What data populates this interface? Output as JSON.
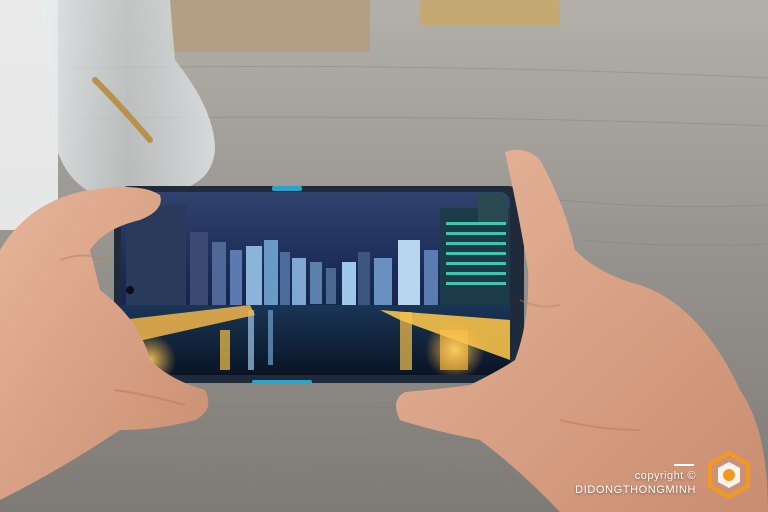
{
  "watermark": {
    "copyright": "copyright ©",
    "brand": "DIDONGTHONGMINH"
  },
  "icons": [
    "camera-shutter-logo-icon"
  ],
  "colors": {
    "table_wood": "#8c8a86",
    "phone_frame": "#1f2a3a",
    "accent_logo": "#f39a1e",
    "city_night_sky": "#1b2a55",
    "city_lights": "#f6c24a"
  }
}
